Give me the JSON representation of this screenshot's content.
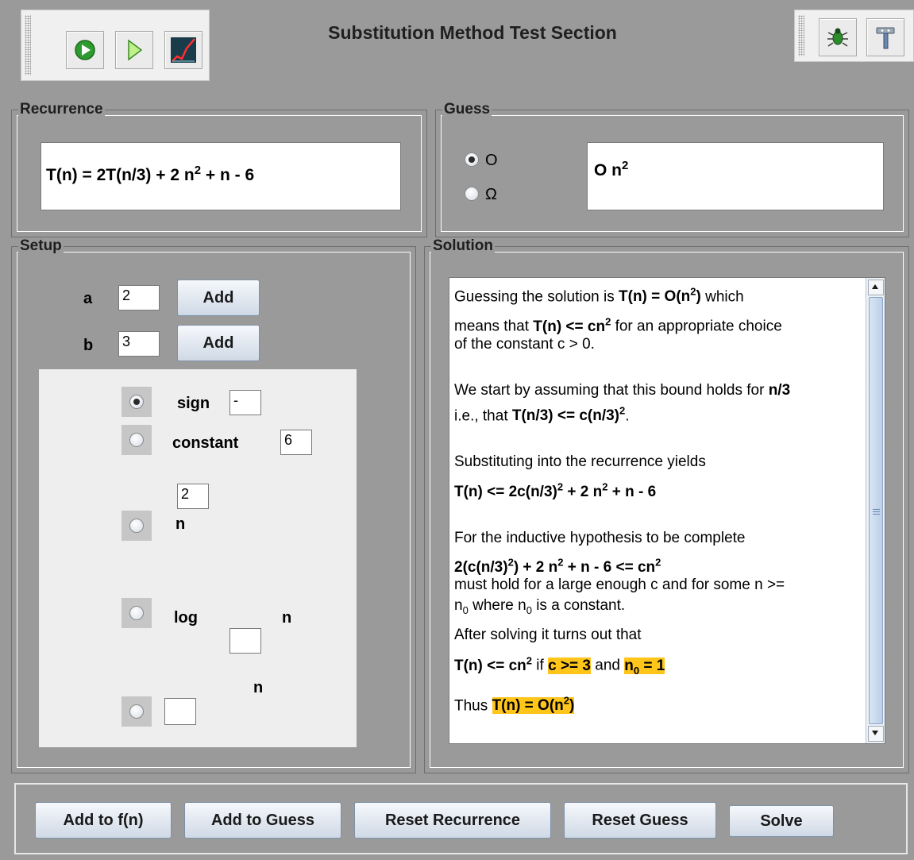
{
  "header": {
    "title": "Substitution Method Test Section",
    "toolbar_left": [
      "run-icon",
      "step-icon",
      "chart-icon"
    ],
    "toolbar_right": [
      "bug-icon",
      "hammer-icon"
    ]
  },
  "recurrence": {
    "legend": "Recurrence",
    "prefix": "T(n) = 2T(n/3) + 2 n",
    "exp": "2",
    "suffix": " + n - 6"
  },
  "guess": {
    "legend": "Guess",
    "option_o": "O",
    "option_omega": "Ω",
    "selected": "O",
    "value_base": "O n",
    "value_exp": "2"
  },
  "setup": {
    "legend": "Setup",
    "a_label": "a",
    "a_value": "2",
    "b_label": "b",
    "b_value": "3",
    "add_label": "Add",
    "sign_label": "sign",
    "sign_value": "-",
    "constant_label": "constant",
    "constant_value": "6",
    "n_exp_value": "2",
    "n_label": "n",
    "log_label": "log",
    "log_n_label": "n",
    "log_base_value": "",
    "exp_n_label": "n",
    "exp_value": ""
  },
  "solution": {
    "legend": "Solution",
    "p1a": "Guessing the solution is ",
    "p1b": "T(n) = O(n",
    "p1c": "2",
    "p1d": ")",
    "p1e": " which",
    "p2a": "means that ",
    "p2b": "T(n) <= cn",
    "p2c": "2",
    "p2d": " for an appropriate choice",
    "p3": "of the constant c > 0.",
    "p4a": "We start by assuming that this bound holds for ",
    "p4b": "n/3",
    "p5a": "i.e., that ",
    "p5b": "T(n/3) <= c(n/3)",
    "p5c": "2",
    "p5d": ".",
    "p6": "Substituting into the recurrence yields",
    "p7a": "T(n) <= 2c(n/3)",
    "p7b": "2",
    "p7c": " + 2 n",
    "p7d": "2",
    "p7e": " + n - 6",
    "p8": "For the inductive hypothesis to be complete",
    "p9a": "2(c(n/3)",
    "p9b": "2",
    "p9c": ") + 2 n",
    "p9d": "2",
    "p9e": " + n - 6 <= cn",
    "p9f": "2",
    "p10": "must hold for a large enough c and for some n >=",
    "p11a": "n",
    "p11b": "0",
    "p11c": " where n",
    "p11d": "0",
    "p11e": " is a constant.",
    "p12": "After solving it turns out that",
    "p13a": "T(n) <= cn",
    "p13b": "2",
    "p13c": " if ",
    "p13d": "c >= 3",
    "p13e": " and ",
    "p13f": "n",
    "p13g": "0",
    "p13h": " = 1",
    "p14a": "Thus ",
    "p14b": "T(n) = O(n",
    "p14c": "2",
    "p14d": ")"
  },
  "actions": {
    "add_fn": "Add to f(n)",
    "add_guess": "Add to Guess",
    "reset_recurrence": "Reset Recurrence",
    "reset_guess": "Reset Guess",
    "solve": "Solve"
  },
  "colors": {
    "highlight": "#ffc51a",
    "panel_bg": "#9a9a9a"
  }
}
